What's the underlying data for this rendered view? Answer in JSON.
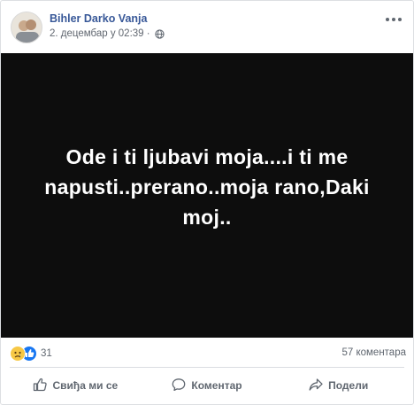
{
  "post": {
    "author": "Bihler Darko Vanja",
    "timestamp": "2. децембар у 02:39 ·",
    "privacy_icon": "globe-icon",
    "image_text": "Ode i ti ljubavi moja....i ti me napusti..prerano..moja rano,Daki moj.."
  },
  "stats": {
    "reaction_icons": [
      "sad-reaction-icon",
      "like-reaction-icon"
    ],
    "reaction_count": "31",
    "comments": "57 коментара"
  },
  "actions": {
    "like": "Свиђа ми се",
    "comment": "Коментар",
    "share": "Подели"
  },
  "colors": {
    "author_link": "#385898",
    "image_background": "#0d0d0d",
    "like_blue": "#1877f2",
    "sad_yellow": "#f7c845",
    "secondary_text": "#606770"
  }
}
